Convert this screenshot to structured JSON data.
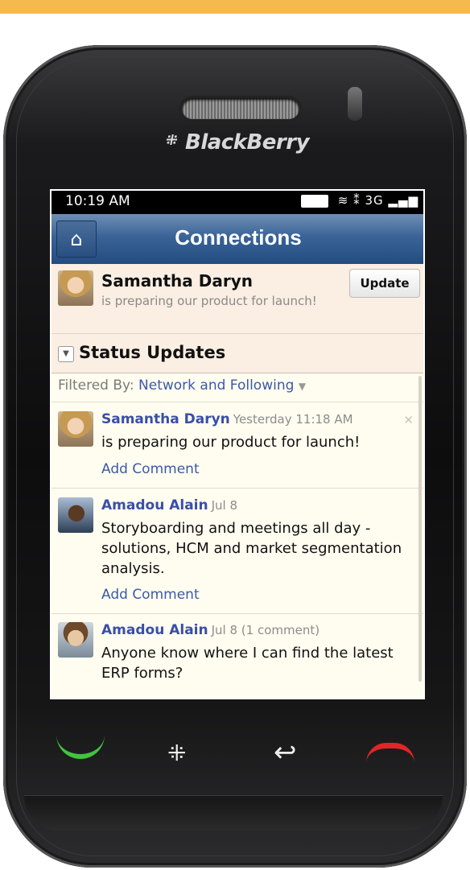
{
  "brand": "BlackBerry",
  "status_bar": {
    "time": "10:19 AM",
    "network": "3G"
  },
  "header": {
    "title": "Connections"
  },
  "profile": {
    "name": "Samantha Daryn",
    "status": "is preparing our product for launch!",
    "update_label": "Update"
  },
  "section": {
    "title": "Status Updates"
  },
  "filter": {
    "label": "Filtered By:",
    "value": "Network and Following"
  },
  "updates": [
    {
      "name": "Samantha Daryn",
      "time": "Yesterday 11:18 AM",
      "message": "is preparing our product for launch!",
      "add_comment": "Add Comment"
    },
    {
      "name": "Amadou Alain",
      "time": "Jul 8",
      "message": "Storyboarding and meetings all day - solutions, HCM and market segmentation analysis.",
      "add_comment": "Add Comment"
    },
    {
      "name": "Amadou Alain",
      "time": "Jul 8 (1 comment)",
      "message": "Anyone know where I can find the latest ERP forms?"
    }
  ],
  "colors": {
    "accent_bar": "#f6b94e",
    "title_bar": "#2f5a8e",
    "link": "#3a4ea8",
    "call": "#42c23f",
    "end": "#e02626"
  }
}
